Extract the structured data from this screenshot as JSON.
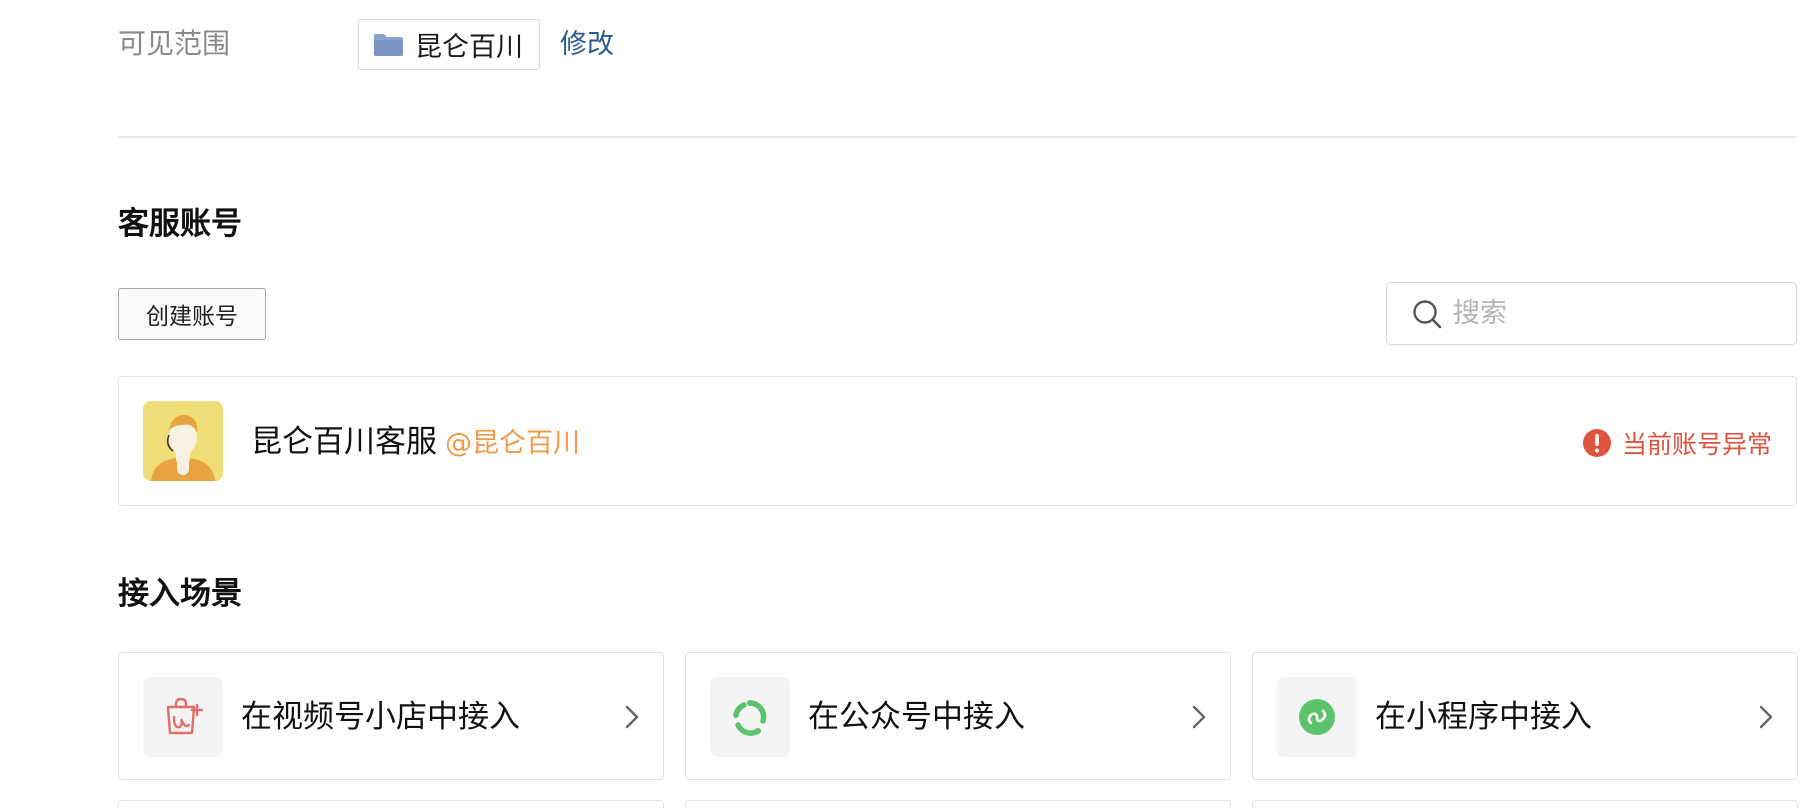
{
  "visible_range": {
    "label": "可见范围",
    "org_name": "昆仑百川",
    "modify_label": "修改",
    "folder_color": "#8aa2cc"
  },
  "accounts_section": {
    "title": "客服账号",
    "create_button": "创建账号",
    "search_placeholder": "搜索",
    "account": {
      "name": "昆仑百川客服",
      "handle": "@昆仑百川",
      "status": "当前账号异常",
      "status_color": "#e0533d",
      "handle_color": "#f09a4a"
    }
  },
  "scenes_section": {
    "title": "接入场景",
    "cards": [
      {
        "label": "在视频号小店中接入",
        "icon": "shop-bag-icon"
      },
      {
        "label": "在公众号中接入",
        "icon": "official-account-icon"
      },
      {
        "label": "在小程序中接入",
        "icon": "mini-program-icon"
      }
    ]
  }
}
